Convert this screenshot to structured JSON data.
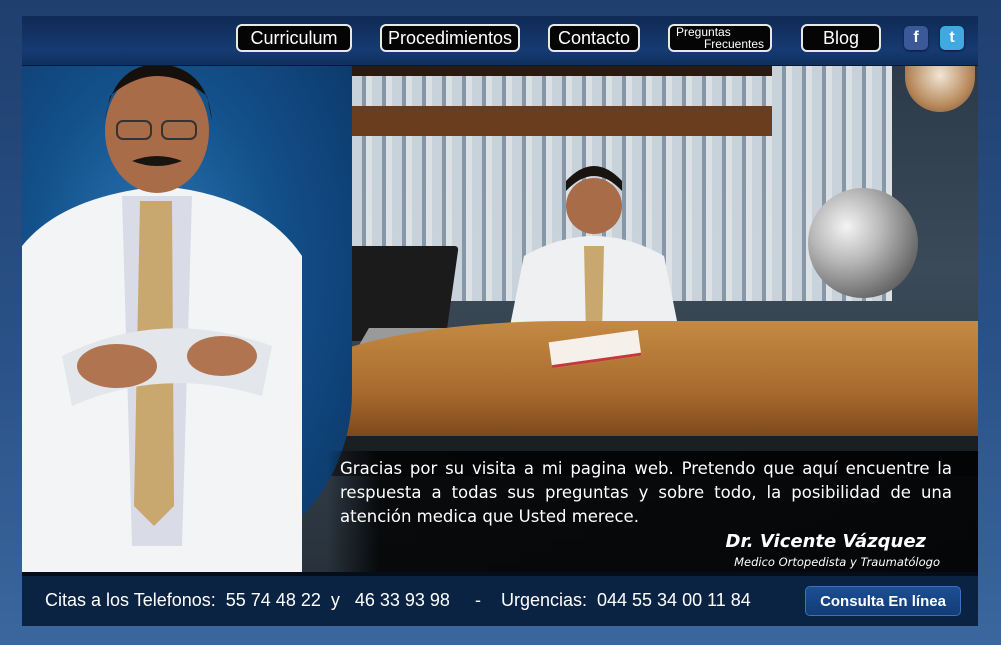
{
  "nav": {
    "items": [
      {
        "label": "Curriculum"
      },
      {
        "label": "Procedimientos"
      },
      {
        "label": "Contacto"
      },
      {
        "label_line1": "Preguntas",
        "label_line2": "Frecuentes"
      },
      {
        "label": "Blog"
      }
    ],
    "social": [
      {
        "name": "facebook",
        "glyph": "f",
        "color": "#3b5998"
      },
      {
        "name": "twitter",
        "glyph": "t",
        "color": "#3fa9e0"
      }
    ]
  },
  "message": {
    "text": "Gracias por su visita a mi pagina web. Pretendo que aquí encuentre la respuesta a todas sus preguntas y sobre todo, la posibilidad de una atención medica que Usted merece.",
    "doctor_name": "Dr. Vicente Vázquez",
    "doctor_title": "Medico Ortopedista y Traumatólogo"
  },
  "footer": {
    "phones_text": "Citas a los Telefonos:  55 74 48 22  y   46 33 93 98     -    Urgencias:  044 55 34 00 11 84",
    "consulta_label": "Consulta En línea"
  },
  "colors": {
    "page_background": "#2a5288",
    "nav_button_bg": "#050505",
    "accent_blue": "#123c76"
  }
}
